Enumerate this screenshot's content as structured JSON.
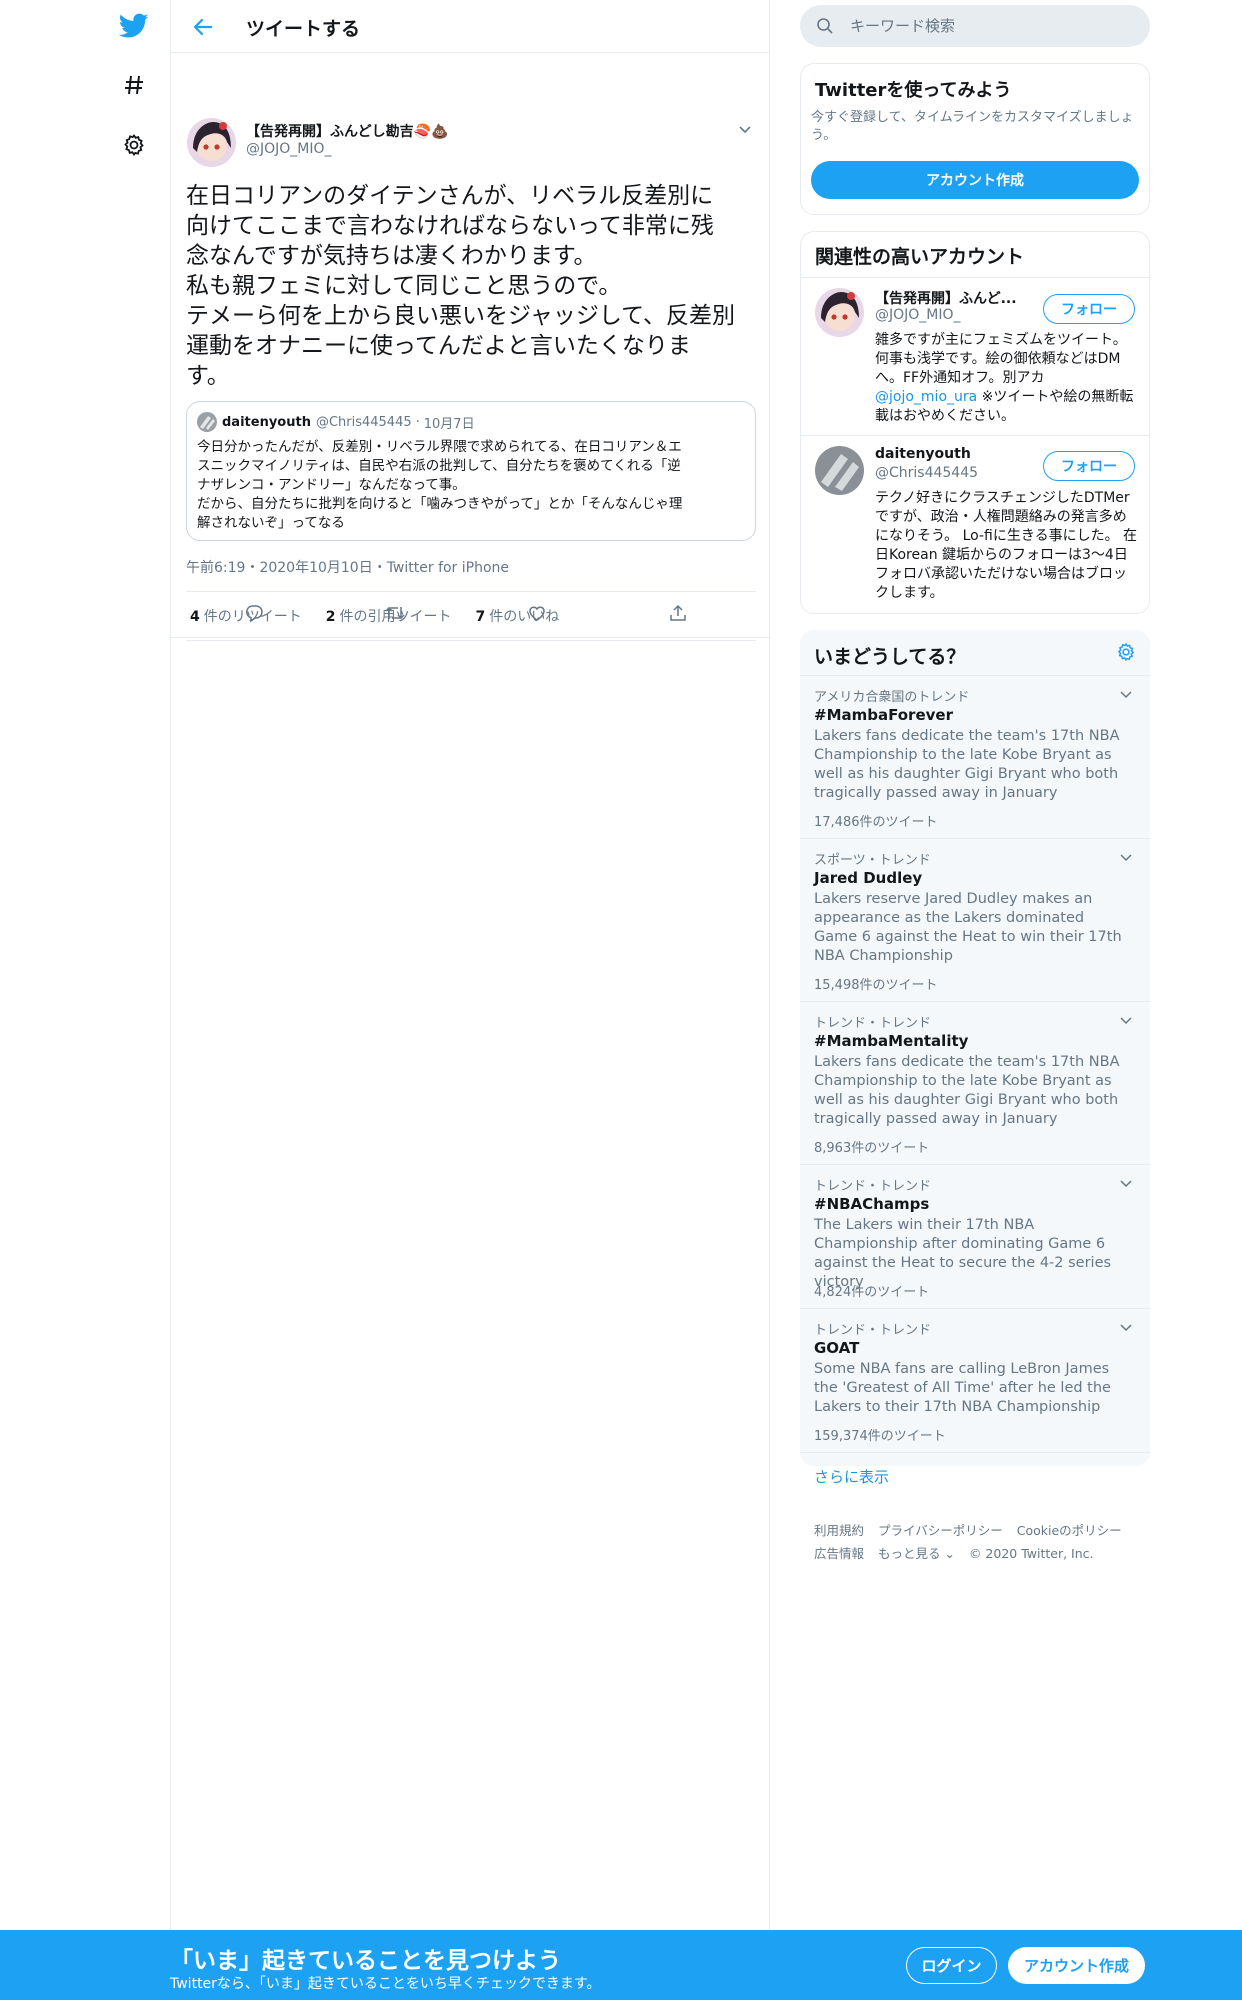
{
  "nav": {
    "icons": [
      "twitter-logo-icon",
      "hashtag-icon",
      "gear-icon"
    ]
  },
  "header": {
    "title": "ツイートする"
  },
  "tweet": {
    "author_name": "【告発再開】ふんどし勘吉🍣💩",
    "author_handle": "@JOJO_MIO_",
    "text": "在日コリアンのダイテンさんが、リベラル反差別に\n向けてここまで言わなければならないって非常に残\n念なんですが気持ちは凄くわかります。\n私も親フェミに対して同じこと思うので。\nテメーら何を上から良い悪いをジャッジして、反差別\n運動をオナニーに使ってんだよと言いたくなりま\nす。",
    "quote": {
      "name": "daitenyouth",
      "handle": "@Chris445445",
      "date": "10月7日",
      "text": "今日分かったんだが、反差別・リベラル界隈で求められてる、在日コリアン＆エ\nスニックマイノリティは、自民や右派の批判して、自分たちを褒めてくれる「逆\nナザレンコ・アンドリー」なんだなって事。\nだから、自分たちに批判を向けると「噛みつきやがって」とか「そんなんじゃ理\n解されないぞ」ってなる"
    },
    "meta": "午前6:19・2020年10月10日・Twitter for iPhone",
    "stats": [
      {
        "count": "4",
        "label": "件のリツイート"
      },
      {
        "count": "2",
        "label": "件の引用ツイート"
      },
      {
        "count": "7",
        "label": "件のいいね"
      }
    ]
  },
  "search": {
    "placeholder": "キーワード検索"
  },
  "signup_panel": {
    "title": "Twitterを使ってみよう",
    "desc": "今すぐ登録して、タイムラインをカスタマイズしましょう。",
    "button": "アカウント作成"
  },
  "related": {
    "title": "関連性の高いアカウント",
    "follow_label": "フォロー",
    "accounts": [
      {
        "name": "【告発再開】ふんど...",
        "handle": "@JOJO_MIO_",
        "bio_a": "雑多ですが主にフェミズムをツイート。 何事も浅学です。絵の御依頼などはDMへ。FF外通知オフ。別アカ",
        "bio_link": "@jojo_mio_ura",
        "bio_b": " ※ツイートや絵の無断転載はおやめください。"
      },
      {
        "name": "daitenyouth",
        "handle": "@Chris445445",
        "bio_a": "テクノ好きにクラスチェンジしたDTMerですが、政治・人権問題絡みの発言多めになりそう。 Lo-fiに生きる事にした。 在日Korean 鍵垢からのフォローは3～4日フォロバ承認いただけない場合はブロックします。"
      }
    ]
  },
  "trends": {
    "title": "いまどうしてる？",
    "items": [
      {
        "category": "アメリカ合衆国のトレンド",
        "name": "#MambaForever",
        "desc": "Lakers fans dedicate the team's 17th NBA Championship to the late Kobe Bryant as well as his daughter Gigi Bryant who both tragically passed away in January",
        "count": "17,486件のツイート"
      },
      {
        "category": "スポーツ・トレンド",
        "name": "Jared Dudley",
        "desc": "Lakers reserve Jared Dudley makes an appearance as the Lakers dominated Game 6 against the Heat to win their 17th NBA Championship",
        "count": "15,498件のツイート"
      },
      {
        "category": "トレンド・トレンド",
        "name": "#MambaMentality",
        "desc": "Lakers fans dedicate the team's 17th NBA Championship to the late Kobe Bryant as well as his daughter Gigi Bryant who both tragically passed away in January",
        "count": "8,963件のツイート"
      },
      {
        "category": "トレンド・トレンド",
        "name": "#NBAChamps",
        "desc": "The Lakers win their 17th NBA Championship after dominating Game 6 against the Heat to secure the 4-2 series victory",
        "count": "4,824件のツイート"
      },
      {
        "category": "トレンド・トレンド",
        "name": "GOAT",
        "desc": "Some NBA fans are calling LeBron James the 'Greatest of All Time' after he led the Lakers to their 17th NBA Championship",
        "count": "159,374件のツイート"
      }
    ],
    "show_more": "さらに表示"
  },
  "footer": {
    "links": [
      "利用規約",
      "プライバシーポリシー",
      "Cookieのポリシー",
      "広告情報",
      "もっと見る ⌄",
      "© 2020 Twitter, Inc."
    ]
  },
  "bottom_bar": {
    "title": "「いま」起きていることを見つけよう",
    "subtitle": "Twitterなら、「いま」起きていることをいち早くチェックできます。",
    "login": "ログイン",
    "signup": "アカウント作成"
  },
  "colors": {
    "accent": "#1da1f2",
    "secondary_text": "#657786",
    "border": "#e6ecf0"
  }
}
